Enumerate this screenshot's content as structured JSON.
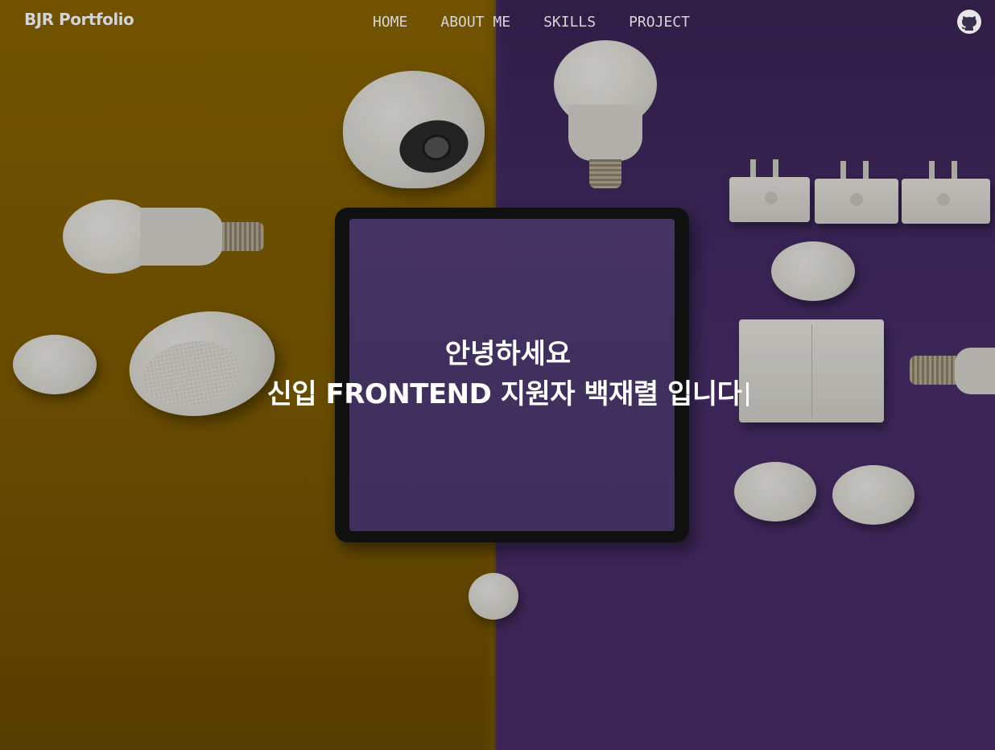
{
  "nav": {
    "brand": "BJR Portfolio",
    "items": [
      {
        "label": "HOME"
      },
      {
        "label": "ABOUT ME"
      },
      {
        "label": "SKILLS"
      },
      {
        "label": "PROJECT"
      }
    ],
    "github_icon": "github-icon"
  },
  "hero": {
    "greeting": "안녕하세요",
    "intro": "신입 FRONTEND 지원자 백재렬 입니다",
    "colors": {
      "left_bg": "#7e5c00",
      "right_bg": "#4a2f6c",
      "text": "#ffffff",
      "nav_text": "#d6d6d6"
    }
  }
}
